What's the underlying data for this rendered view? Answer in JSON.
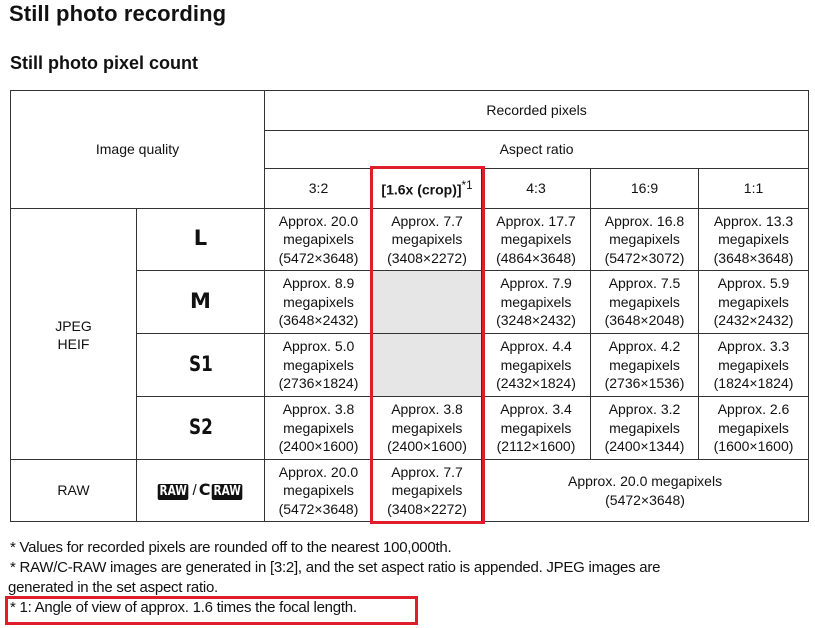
{
  "page": {
    "title": "Still photo recording",
    "subtitle": "Still photo pixel count"
  },
  "table": {
    "header": {
      "image_quality": "Image quality",
      "recorded_pixels": "Recorded pixels",
      "aspect_ratio": "Aspect ratio",
      "columns": [
        "3:2",
        "[1.6x (crop)]",
        "4:3",
        "16:9",
        "1:1"
      ],
      "crop_footnote_marker": "*1"
    },
    "group_jpeg": "JPEG\nHEIF",
    "group_jpeg_line1": "JPEG",
    "group_jpeg_line2": "HEIF",
    "group_raw": "RAW",
    "raw_quality": {
      "badge1": "RAW",
      "separator": "/",
      "badge2_prefix": "C",
      "badge2": "RAW"
    },
    "rows": [
      {
        "quality": "L",
        "cells": [
          {
            "line1": "Approx. 20.0",
            "line2": "megapixels",
            "line3": "(5472×3648)"
          },
          {
            "line1": "Approx. 7.7",
            "line2": "megapixels",
            "line3": "(3408×2272)"
          },
          {
            "line1": "Approx. 17.7",
            "line2": "megapixels",
            "line3": "(4864×3648)"
          },
          {
            "line1": "Approx. 16.8",
            "line2": "megapixels",
            "line3": "(5472×3072)"
          },
          {
            "line1": "Approx. 13.3",
            "line2": "megapixels",
            "line3": "(3648×3648)"
          }
        ]
      },
      {
        "quality": "M",
        "cells": [
          {
            "line1": "Approx. 8.9",
            "line2": "megapixels",
            "line3": "(3648×2432)"
          },
          null,
          {
            "line1": "Approx. 7.9",
            "line2": "megapixels",
            "line3": "(3248×2432)"
          },
          {
            "line1": "Approx. 7.5",
            "line2": "megapixels",
            "line3": "(3648×2048)"
          },
          {
            "line1": "Approx. 5.9",
            "line2": "megapixels",
            "line3": "(2432×2432)"
          }
        ]
      },
      {
        "quality": "S1",
        "cells": [
          {
            "line1": "Approx. 5.0",
            "line2": "megapixels",
            "line3": "(2736×1824)"
          },
          null,
          {
            "line1": "Approx. 4.4",
            "line2": "megapixels",
            "line3": "(2432×1824)"
          },
          {
            "line1": "Approx. 4.2",
            "line2": "megapixels",
            "line3": "(2736×1536)"
          },
          {
            "line1": "Approx. 3.3",
            "line2": "megapixels",
            "line3": "(1824×1824)"
          }
        ]
      },
      {
        "quality": "S2",
        "cells": [
          {
            "line1": "Approx. 3.8",
            "line2": "megapixels",
            "line3": "(2400×1600)"
          },
          {
            "line1": "Approx. 3.8",
            "line2": "megapixels",
            "line3": "(2400×1600)"
          },
          {
            "line1": "Approx. 3.4",
            "line2": "megapixels",
            "line3": "(2112×1600)"
          },
          {
            "line1": "Approx. 3.2",
            "line2": "megapixels",
            "line3": "(2400×1344)"
          },
          {
            "line1": "Approx. 2.6",
            "line2": "megapixels",
            "line3": "(1600×1600)"
          }
        ]
      }
    ],
    "raw_row": {
      "cell_32": {
        "line1": "Approx. 20.0",
        "line2": "megapixels",
        "line3": "(5472×3648)"
      },
      "cell_crop": {
        "line1": "Approx. 7.7",
        "line2": "megapixels",
        "line3": "(3408×2272)"
      },
      "cell_merged": {
        "line1": "Approx. 20.0 megapixels",
        "line2": "(5472×3648)"
      }
    }
  },
  "notes": [
    "* Values for recorded pixels are rounded off to the nearest 100,000th.",
    "* RAW/C-RAW images are generated in [3:2], and the set aspect ratio is appended. JPEG images are",
    "generated in the set aspect ratio.",
    "* 1: Angle of view of approx. 1.6 times the focal length."
  ],
  "colors": {
    "highlight_red": "#e01e2b",
    "unavailable_cell": "#e6e6e6"
  }
}
